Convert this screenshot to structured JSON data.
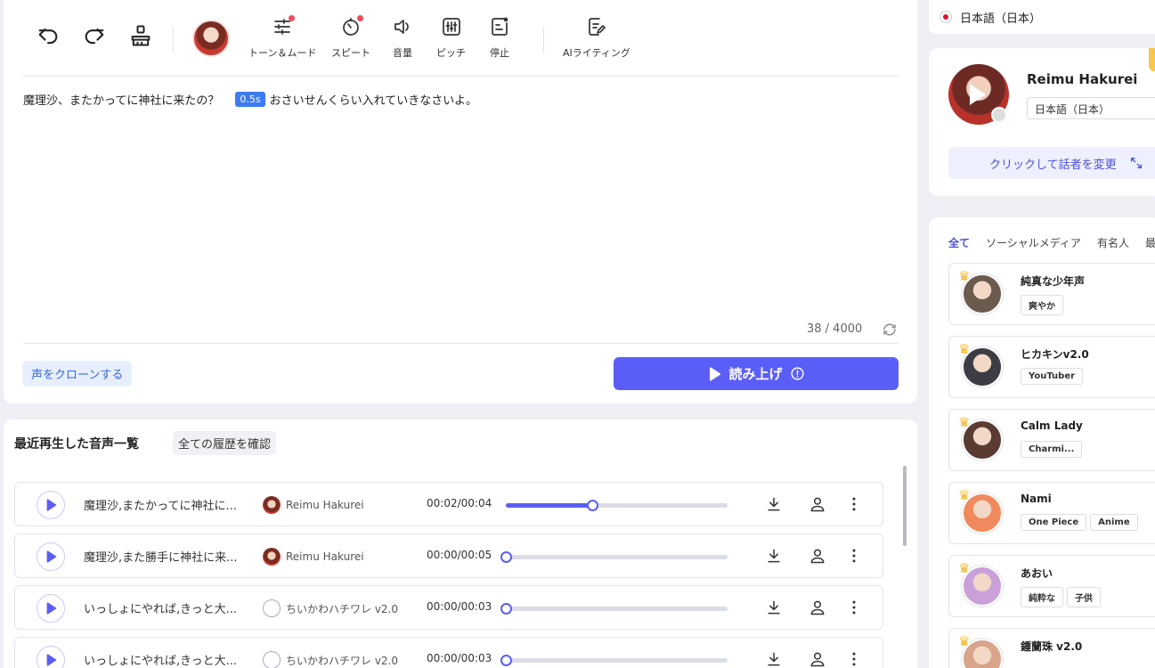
{
  "toolbar": {
    "tools": [
      {
        "label": "トーン＆ムード",
        "icon": "sliders-icon",
        "dot": true
      },
      {
        "label": "スピート",
        "icon": "speed-timer-icon",
        "dot": true
      },
      {
        "label": "音量",
        "icon": "volume-icon",
        "dot": false
      },
      {
        "label": "ピッチ",
        "icon": "pitch-icon",
        "dot": false
      },
      {
        "label": "停止",
        "icon": "pause-insert-icon",
        "dot": false
      },
      {
        "label": "AIライティング",
        "icon": "ai-writing-icon",
        "dot": false
      }
    ]
  },
  "editor": {
    "text_before": "魔理沙、またかってに神社に来たの？",
    "pause_badge": "0.5s",
    "text_after": "おさいせんくらい入れていきなさいよ。",
    "counter": "38 / 4000",
    "clone_label": "声をクローンする",
    "read_label": "読み上げ"
  },
  "recent": {
    "title": "最近再生した音声一覧",
    "history_label": "全ての履歴を確認",
    "rows": [
      {
        "title": "魔理沙,またかってに神社に...",
        "voice": "Reimu Hakurei",
        "time": "00:02/00:04",
        "progress": 0.39,
        "avatar": "reimu"
      },
      {
        "title": "魔理沙,また勝手に神社に来...",
        "voice": "Reimu Hakurei",
        "time": "00:00/00:05",
        "progress": 0,
        "avatar": "reimu"
      },
      {
        "title": "いっしょにやれば,きっと大...",
        "voice": "ちいかわハチワレ v2.0",
        "time": "00:00/00:03",
        "progress": 0,
        "avatar": "cat"
      },
      {
        "title": "いっしょにやれば,きっと大...",
        "voice": "ちいかわハチワレ v2.0",
        "time": "00:00/00:03",
        "progress": 0,
        "avatar": "cat"
      }
    ]
  },
  "language": {
    "label": "日本語（日本）"
  },
  "speaker": {
    "name": "Reimu Hakurei",
    "language": "日本語（日本）",
    "change_label": "クリックして話者を変更"
  },
  "voices": {
    "tabs": [
      "全て",
      "ソーシャルメディア",
      "有名人",
      "最近"
    ],
    "items": [
      {
        "name": "純真な少年声",
        "tags": [
          "爽やか"
        ],
        "color": "#6b5a4e"
      },
      {
        "name": "ヒカキンv2.0",
        "tags": [
          "YouTuber"
        ],
        "color": "#3c3c44"
      },
      {
        "name": "Calm Lady",
        "tags": [
          "Charmi..."
        ],
        "color": "#5a3b32"
      },
      {
        "name": "Nami",
        "tags": [
          "One Piece",
          "Anime"
        ],
        "color": "#f08a5d"
      },
      {
        "name": "あおい",
        "tags": [
          "純粋な",
          "子供"
        ],
        "color": "#c9a0d8"
      },
      {
        "name": "鍾蘭珠 v2.0",
        "tags": [],
        "color": "#d8a48a"
      }
    ]
  },
  "colors": {
    "accent": "#5b5ef6",
    "pause_badge": "#3d7bf2",
    "dot": "#ef4b5a",
    "crown": "#f3b82a"
  }
}
